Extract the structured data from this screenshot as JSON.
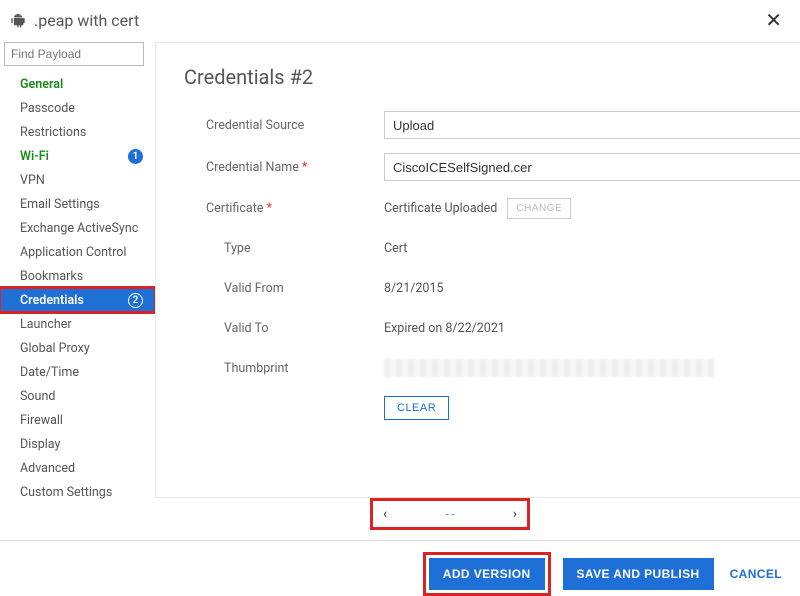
{
  "header": {
    "title": ".peap with cert"
  },
  "search": {
    "placeholder": "Find Payload"
  },
  "sidebar": {
    "items": [
      {
        "label": "General"
      },
      {
        "label": "Passcode"
      },
      {
        "label": "Restrictions"
      },
      {
        "label": "Wi-Fi",
        "badge": "1"
      },
      {
        "label": "VPN"
      },
      {
        "label": "Email Settings"
      },
      {
        "label": "Exchange ActiveSync"
      },
      {
        "label": "Application Control"
      },
      {
        "label": "Bookmarks"
      },
      {
        "label": "Credentials",
        "badge": "2"
      },
      {
        "label": "Launcher"
      },
      {
        "label": "Global Proxy"
      },
      {
        "label": "Date/Time"
      },
      {
        "label": "Sound"
      },
      {
        "label": "Firewall"
      },
      {
        "label": "Display"
      },
      {
        "label": "Advanced"
      },
      {
        "label": "Custom Settings"
      }
    ]
  },
  "form": {
    "heading": "Credentials #2",
    "labels": {
      "source": "Credential Source",
      "name": "Credential Name",
      "certificate": "Certificate",
      "type": "Type",
      "valid_from": "Valid From",
      "valid_to": "Valid To",
      "thumbprint": "Thumbprint"
    },
    "values": {
      "source": "Upload",
      "name": "CiscoICESelfSigned.cer",
      "uploaded_text": "Certificate Uploaded",
      "change": "CHANGE",
      "type": "Cert",
      "valid_from": "8/21/2015",
      "valid_to": "Expired on 8/22/2021",
      "clear": "CLEAR"
    }
  },
  "pager": {
    "mid": "- -"
  },
  "footer": {
    "add_version": "ADD VERSION",
    "save_publish": "SAVE AND PUBLISH",
    "cancel": "CANCEL"
  }
}
